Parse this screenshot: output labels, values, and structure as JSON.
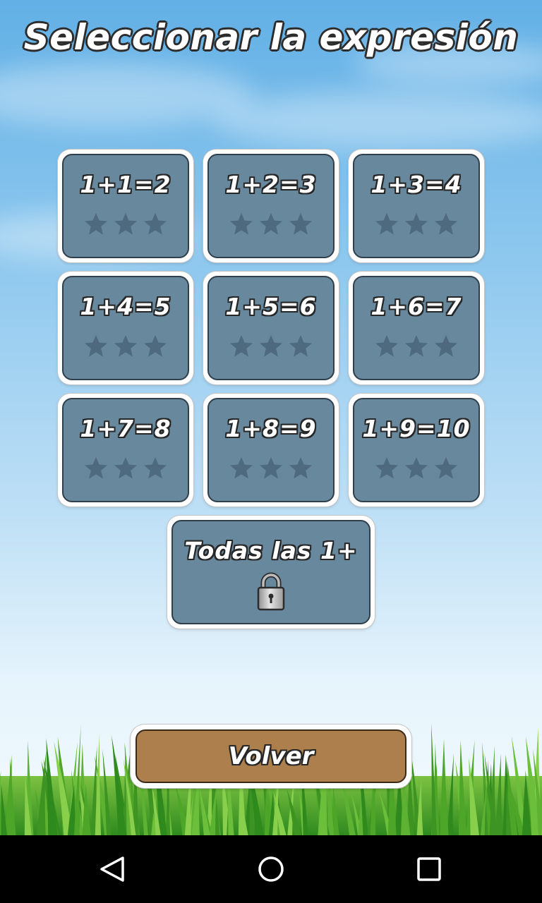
{
  "title": "Seleccionar la expresión",
  "levels": [
    {
      "label": "1+1=2",
      "stars_earned": 0,
      "stars_total": 3,
      "locked": false
    },
    {
      "label": "1+2=3",
      "stars_earned": 0,
      "stars_total": 3,
      "locked": false
    },
    {
      "label": "1+3=4",
      "stars_earned": 0,
      "stars_total": 3,
      "locked": false
    },
    {
      "label": "1+4=5",
      "stars_earned": 0,
      "stars_total": 3,
      "locked": false
    },
    {
      "label": "1+5=6",
      "stars_earned": 0,
      "stars_total": 3,
      "locked": false
    },
    {
      "label": "1+6=7",
      "stars_earned": 0,
      "stars_total": 3,
      "locked": false
    },
    {
      "label": "1+7=8",
      "stars_earned": 0,
      "stars_total": 3,
      "locked": false
    },
    {
      "label": "1+8=9",
      "stars_earned": 0,
      "stars_total": 3,
      "locked": false
    },
    {
      "label": "1+9=10",
      "stars_earned": 0,
      "stars_total": 3,
      "locked": false
    }
  ],
  "all_levels": {
    "label": "Todas las 1+",
    "locked": true,
    "icon": "lock-icon"
  },
  "back_button": {
    "label": "Volver"
  },
  "navbar": {
    "items": [
      "back-icon",
      "home-icon",
      "recents-icon"
    ]
  },
  "colors": {
    "card_fill": "#68889e",
    "star_empty": "#4e6a7e",
    "back_fill": "#ad7f4c",
    "sky_top": "#62b0e6"
  }
}
